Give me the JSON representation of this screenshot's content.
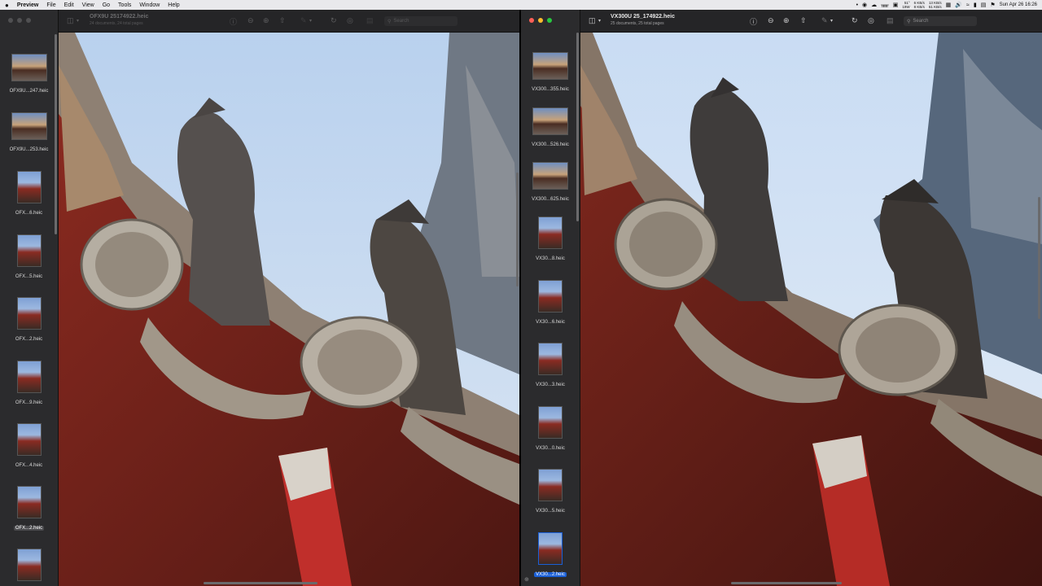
{
  "menubar": {
    "apple": "",
    "app_name": "Preview",
    "menus": [
      "File",
      "Edit",
      "View",
      "Go",
      "Tools",
      "Window",
      "Help"
    ],
    "status": {
      "temp_top": "51°",
      "temp_bottom": "19W",
      "net_up": "6 KB/s",
      "net_down": "8 KB/s",
      "disk_read": "13 KB/s",
      "disk_write": "51 KB/s",
      "datetime": "Sun Apr 26  16:26"
    }
  },
  "left_window": {
    "title": "OFX9U 25174922.heic",
    "subtitle": "24 documents, 24 total pages",
    "search_placeholder": "Search",
    "thumbnails": [
      {
        "label": "OFX9U...247.heic",
        "shape": "landscape"
      },
      {
        "label": "OFX9U...253.heic",
        "shape": "landscape"
      },
      {
        "label": "OFX...6.heic",
        "shape": "portrait"
      },
      {
        "label": "OFX...5.heic",
        "shape": "portrait"
      },
      {
        "label": "OFX...2.heic",
        "shape": "portrait"
      },
      {
        "label": "OFX...9.heic",
        "shape": "portrait"
      },
      {
        "label": "OFX...4.heic",
        "shape": "portrait"
      },
      {
        "label": "OFX...2.heic",
        "shape": "portrait",
        "state": "selected-muted"
      },
      {
        "label": "",
        "shape": "portrait"
      }
    ]
  },
  "right_window": {
    "title": "VX300U 25_174922.heic",
    "subtitle": "25 documents, 25 total pages",
    "search_placeholder": "Search",
    "thumbnails": [
      {
        "label": "VX300...355.heic",
        "shape": "landscape"
      },
      {
        "label": "VX300...526.heic",
        "shape": "landscape"
      },
      {
        "label": "VX300...625.heic",
        "shape": "landscape"
      },
      {
        "label": "VX30...8.heic",
        "shape": "portrait"
      },
      {
        "label": "VX30...6.heic",
        "shape": "portrait"
      },
      {
        "label": "VX30...3.heic",
        "shape": "portrait"
      },
      {
        "label": "VX30...0.heic",
        "shape": "portrait"
      },
      {
        "label": "VX30...5.heic",
        "shape": "portrait"
      },
      {
        "label": "VX30...2.heic",
        "shape": "portrait",
        "state": "selected"
      }
    ]
  },
  "icons": {
    "sidebar_toggle": "sidebar-icon",
    "info": "info-icon",
    "zoom_out": "zoom-out-icon",
    "zoom_in": "zoom-in-icon",
    "share": "share-icon",
    "markup": "pen-icon",
    "rotate": "rotate-icon",
    "annotate": "annotate-icon",
    "form": "form-icon",
    "search": "search-icon"
  },
  "colors": {
    "selection": "#1a5fd6",
    "sky": "#c8dcf2",
    "beam_red": "#7a231c"
  }
}
